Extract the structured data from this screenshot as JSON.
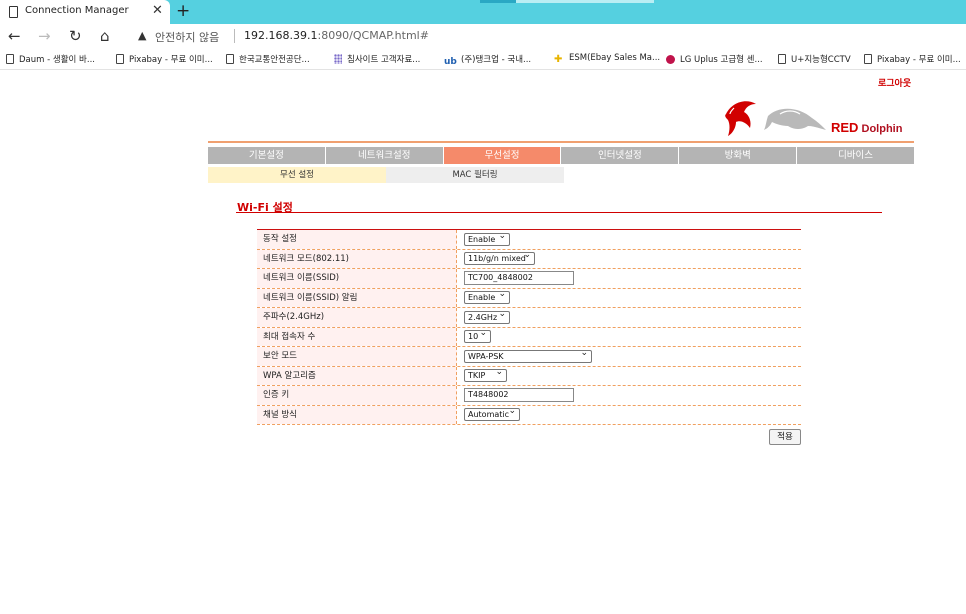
{
  "browser": {
    "tab_title": "Connection Manager",
    "tab_close": "✕",
    "new_tab": "+",
    "nav": {
      "back": "←",
      "forward": "→",
      "reload": "↻",
      "home": "⌂"
    },
    "security_icon": "warning-icon",
    "security_warning": "▲",
    "security_label": "안전하지 않음",
    "url_host": "192.168.39.1",
    "url_rest": ":8090/QCMAP.html#",
    "bookmarks": [
      {
        "label": "Daum - 생활이 바...",
        "icon": "page-icon"
      },
      {
        "label": "Pixabay - 무료 이미...",
        "icon": "page-icon"
      },
      {
        "label": "한국교통안전공단...",
        "icon": "page-icon"
      },
      {
        "label": "침사이트 고객자료...",
        "icon": "grid-icon"
      },
      {
        "label": "(주)탱크업 - 국내...",
        "icon": "ub-icon"
      },
      {
        "label": "ESM(Ebay Sales Ma...",
        "icon": "esm-icon"
      },
      {
        "label": "LG Uplus 고급형 센...",
        "icon": "lg-icon"
      },
      {
        "label": "U+지능형CCTV",
        "icon": "page-icon"
      },
      {
        "label": "Pixabay - 무료 이미...",
        "icon": "page-icon"
      }
    ],
    "bookmark_glyphs": {
      "ub": "ub",
      "esm": "✚"
    }
  },
  "page": {
    "logout": "로그아웃",
    "logo": {
      "brand_red": "RED",
      "brand_name": "Dolphin",
      "colors": {
        "red": "#d10000",
        "gray": "#b9b9b9"
      }
    },
    "menu": [
      {
        "label": "기본설정",
        "active": false
      },
      {
        "label": "네트워크설정",
        "active": false
      },
      {
        "label": "무선설정",
        "active": true
      },
      {
        "label": "인터넷설정",
        "active": false
      },
      {
        "label": "방화벽",
        "active": false
      },
      {
        "label": "디바이스",
        "active": false
      }
    ],
    "submenu": [
      {
        "label": "무선 설정",
        "active": true
      },
      {
        "label": "MAC 필터링",
        "active": false
      }
    ],
    "section_title": "Wi-Fi 설정",
    "settings": [
      {
        "label": "동작 설정",
        "type": "select",
        "value": "Enable"
      },
      {
        "label": "네트워크 모드(802.11)",
        "type": "select",
        "value": "11b/g/n mixed"
      },
      {
        "label": "네트워크 이름(SSID)",
        "type": "text",
        "value": "TC700_4848002"
      },
      {
        "label": "네트워크 이름(SSID) 알림",
        "type": "select",
        "value": "Enable"
      },
      {
        "label": "주파수(2.4GHz)",
        "type": "select",
        "value": "2.4GHz"
      },
      {
        "label": "최대 접속자 수",
        "type": "select",
        "value": "10"
      },
      {
        "label": "보안 모드",
        "type": "select",
        "value": "WPA-PSK"
      },
      {
        "label": "WPA 알고리즘",
        "type": "select",
        "value": "TKIP"
      },
      {
        "label": "인증 키",
        "type": "text",
        "value": "T4848002"
      },
      {
        "label": "채널 방식",
        "type": "select",
        "value": "Automatic"
      }
    ],
    "apply_button": "적용",
    "colors": {
      "accent": "#d00000",
      "menu_active": "#f58a6a",
      "menu_bg": "#b4b4b4"
    }
  }
}
